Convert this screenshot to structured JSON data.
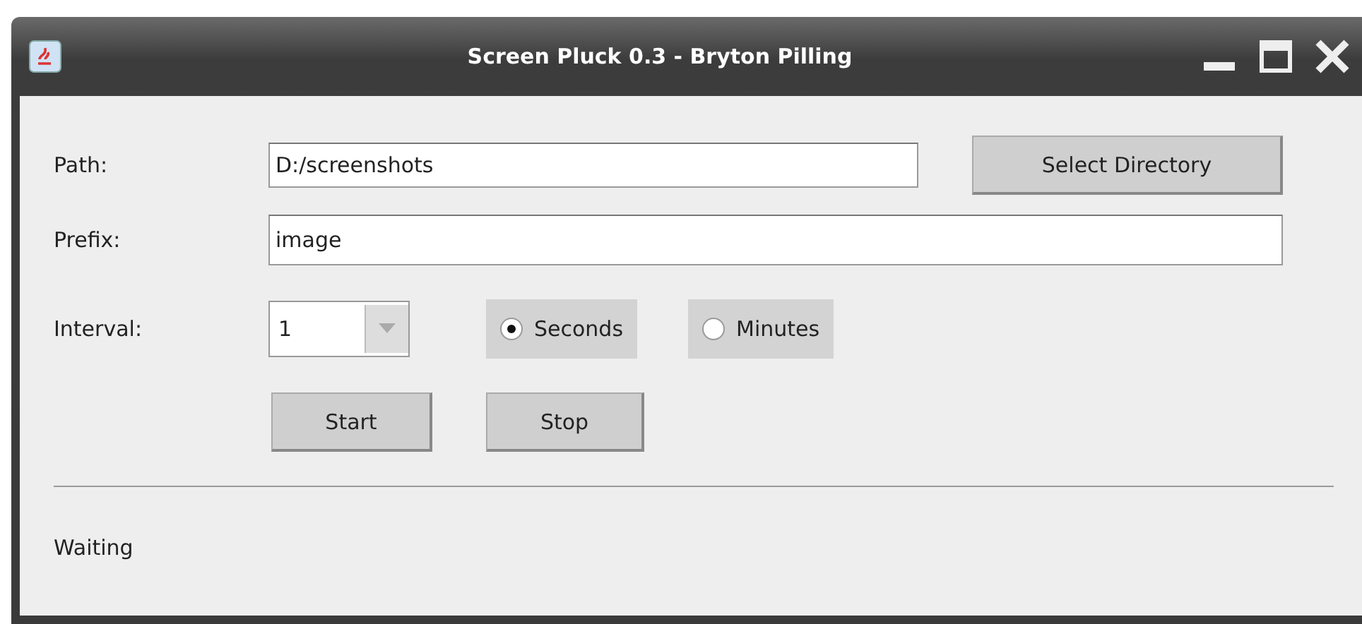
{
  "window": {
    "title": "Screen Pluck 0.3 - Bryton Pilling"
  },
  "path": {
    "label": "Path:",
    "value": "D:/screenshots"
  },
  "select_directory_button": "Select Directory",
  "prefix": {
    "label": "Prefix:",
    "value": "image"
  },
  "interval": {
    "label": "Interval:",
    "value": "1"
  },
  "units": [
    {
      "label": "Seconds",
      "selected": true
    },
    {
      "label": "Minutes",
      "selected": false
    }
  ],
  "buttons": [
    "Start",
    "Stop"
  ],
  "status": "Waiting"
}
